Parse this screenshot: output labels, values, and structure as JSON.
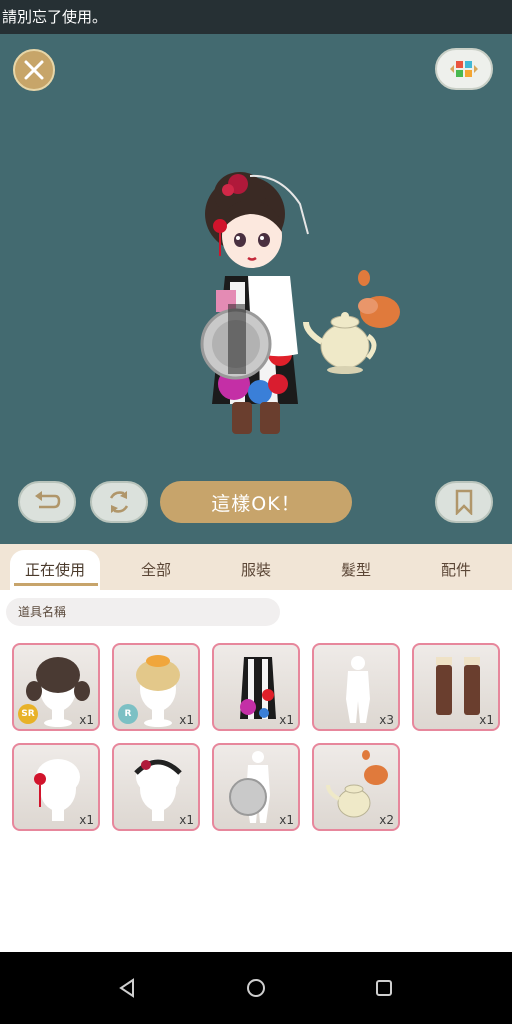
{
  "toast": {
    "text": "請別忘了使用。"
  },
  "stage": {
    "ok_button": "這樣OK！"
  },
  "tabs": [
    {
      "label": "正在使用",
      "active": true
    },
    {
      "label": "全部",
      "active": false
    },
    {
      "label": "服裝",
      "active": false
    },
    {
      "label": "髮型",
      "active": false
    },
    {
      "label": "配件",
      "active": false
    }
  ],
  "filter": {
    "label": "道具名稱"
  },
  "items": [
    {
      "name": "pigtail hair",
      "rarity": "SR",
      "count": "x1"
    },
    {
      "name": "blonde bun hair",
      "rarity": "R",
      "count": "x1"
    },
    {
      "name": "floral kimono",
      "rarity": "",
      "count": "x1"
    },
    {
      "name": "white body",
      "rarity": "",
      "count": "x3"
    },
    {
      "name": "brown boots",
      "rarity": "",
      "count": "x1"
    },
    {
      "name": "red hairpin",
      "rarity": "",
      "count": "x1"
    },
    {
      "name": "flower headband",
      "rarity": "",
      "count": "x1"
    },
    {
      "name": "silver tray",
      "rarity": "",
      "count": "x1"
    },
    {
      "name": "teapot",
      "rarity": "",
      "count": "x2"
    }
  ],
  "colors": {
    "stage": "#436a70",
    "accent": "#c7a46b",
    "item_border": "#e7879c",
    "sr": "#e8b228",
    "r": "#7cc0c4"
  }
}
